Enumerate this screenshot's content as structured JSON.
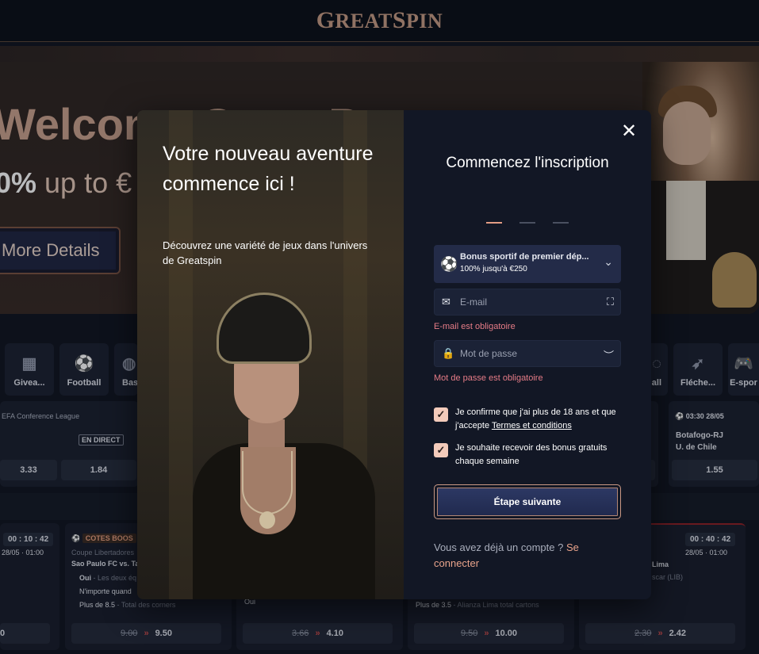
{
  "header": {
    "logo_big1": "G",
    "logo_small1": "REAT",
    "logo_big2": "S",
    "logo_small2": "PIN"
  },
  "hero": {
    "title": "Welcome Great B",
    "sub_bold": "0%",
    "sub_rest": " up to €",
    "button": "More Details"
  },
  "categories": [
    {
      "label": "Givea...",
      "icon": "gift-grid-icon"
    },
    {
      "label": "Football",
      "icon": "football-icon"
    },
    {
      "label": "Bas",
      "icon": "basketball-icon"
    },
    {
      "label": "all",
      "icon": "ball-icon"
    },
    {
      "label": "Fléche...",
      "icon": "darts-icon"
    },
    {
      "label": "E-spor",
      "icon": "gamepad-icon"
    }
  ],
  "middle_cards": {
    "left": {
      "league": "EFA Conference League",
      "live": "EN DIRECT",
      "odds": [
        "3.33",
        "1.84"
      ]
    },
    "right": {
      "time": "03:30",
      "date": "28/05",
      "team1": "Botafogo-RJ",
      "team2": "U. de Chile",
      "odd": "1.55"
    }
  },
  "bottom_cards": {
    "c1": {
      "timer": "00 : 10 : 42",
      "date": "28/05 · 01:00",
      "odd": "0"
    },
    "c2": {
      "badge": "COTES BOOS",
      "league": "Coupe Libertadores",
      "match": "Sao Paulo FC vs. Ta",
      "l1": "Oui",
      "l1b": " - Les deux éq",
      "l2": "N'importe quand",
      "l3": "Plus de 8.5",
      "l3b": " - Total des corners",
      "old": "9.00",
      "new": "9.50"
    },
    "c3": {
      "l1": "Oui",
      "old": "3.66",
      "new": "4.10"
    },
    "c4": {
      "l1": "Plus de 3.5",
      "l1b": " - Alianza Lima total cartons",
      "old": "9.50",
      "new": "10.00"
    },
    "c5": {
      "timer": "00 : 40 : 42",
      "date": "28/05 · 01:00",
      "l1": "Lima",
      "l2": "scar (LIB)",
      "old": "2.30",
      "new": "2.42"
    }
  },
  "modal": {
    "left_title": "Votre nouveau aventure commence ici !",
    "left_text": "Découvrez une variété de jeux dans l'univers de Greatspin",
    "title": "Commencez l'inscription",
    "bonus": {
      "title": "Bonus sportif de premier dép...",
      "sub": "100% jusqu'à €250",
      "icon": "soccer-ball-icon"
    },
    "email": {
      "placeholder": "E-mail",
      "error": "E-mail est obligatoire"
    },
    "password": {
      "placeholder": "Mot de passe",
      "error": "Mot de passe est obligatoire"
    },
    "check1": {
      "text": "Je confirme que j'ai plus de 18 ans et que j'accepte ",
      "link": "Termes et conditions",
      "checked": true
    },
    "check2": {
      "text": "Je souhaite recevoir des bonus gratuits chaque semaine",
      "checked": true
    },
    "next_button": "Étape suivante",
    "login_prompt": "Vous avez déjà un compte ? ",
    "login_link": "Se connecter"
  },
  "colors": {
    "accent": "#e8a38b",
    "error": "#e67c87",
    "modal_bg": "#121725",
    "primary_button": "#2e3a66"
  }
}
